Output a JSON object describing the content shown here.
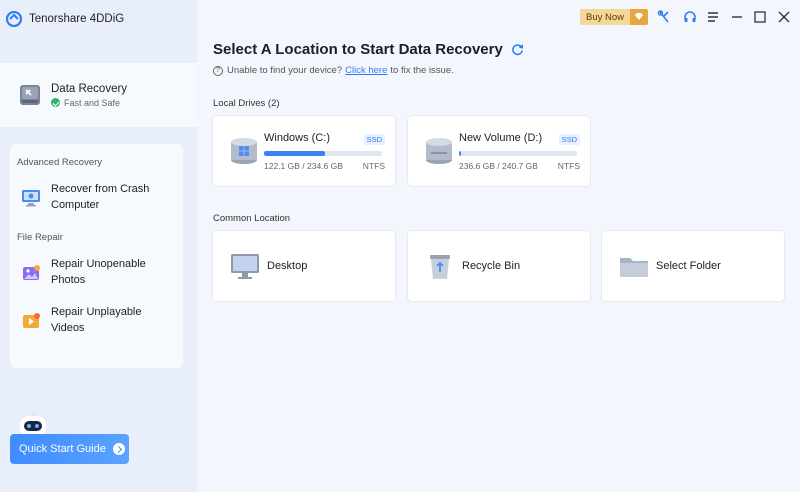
{
  "app": {
    "title": "Tenorshare 4DDiG"
  },
  "titlebar": {
    "buy_now": "Buy Now"
  },
  "sidebar": {
    "primary": {
      "title": "Data Recovery",
      "status": "Fast and Safe"
    },
    "groups": [
      {
        "label": "Advanced Recovery",
        "items": [
          {
            "label": "Recover from Crash\nComputer",
            "icon": "crash-computer-icon"
          }
        ]
      },
      {
        "label": "File Repair",
        "items": [
          {
            "label": "Repair Unopenable\nPhotos",
            "icon": "photo-repair-icon"
          },
          {
            "label": "Repair Unplayable\nVideos",
            "icon": "video-repair-icon"
          }
        ]
      }
    ],
    "quick_start": "Quick Start Guide"
  },
  "main": {
    "heading": "Select A Location to Start Data Recovery",
    "help": {
      "prefix": "Unable to find your device?",
      "link": "Click here",
      "suffix": "to fix the issue."
    },
    "local_drives_label": "Local Drives (2)",
    "drives": [
      {
        "name": "Windows (C:)",
        "type": "SSD",
        "used": "122.1 GB",
        "total": "234.6 GB",
        "capacity": "122.1 GB / 234.6 GB",
        "fs": "NTFS",
        "used_fraction": 0.52
      },
      {
        "name": "New Volume (D:)",
        "type": "SSD",
        "used": "236.6 GB",
        "total": "240.7 GB",
        "capacity": "236.6 GB / 240.7 GB",
        "fs": "NTFS",
        "used_fraction": 0.02
      }
    ],
    "common_location_label": "Common Location",
    "locations": [
      {
        "name": "Desktop",
        "icon": "desktop-icon"
      },
      {
        "name": "Recycle Bin",
        "icon": "recycle-bin-icon"
      },
      {
        "name": "Select Folder",
        "icon": "folder-icon"
      }
    ]
  },
  "colors": {
    "accent": "#3b82f6",
    "buy_now_bg": "#f3d79b",
    "sidebar_bg": "#e8effa",
    "main_bg": "#f3f6fc"
  }
}
